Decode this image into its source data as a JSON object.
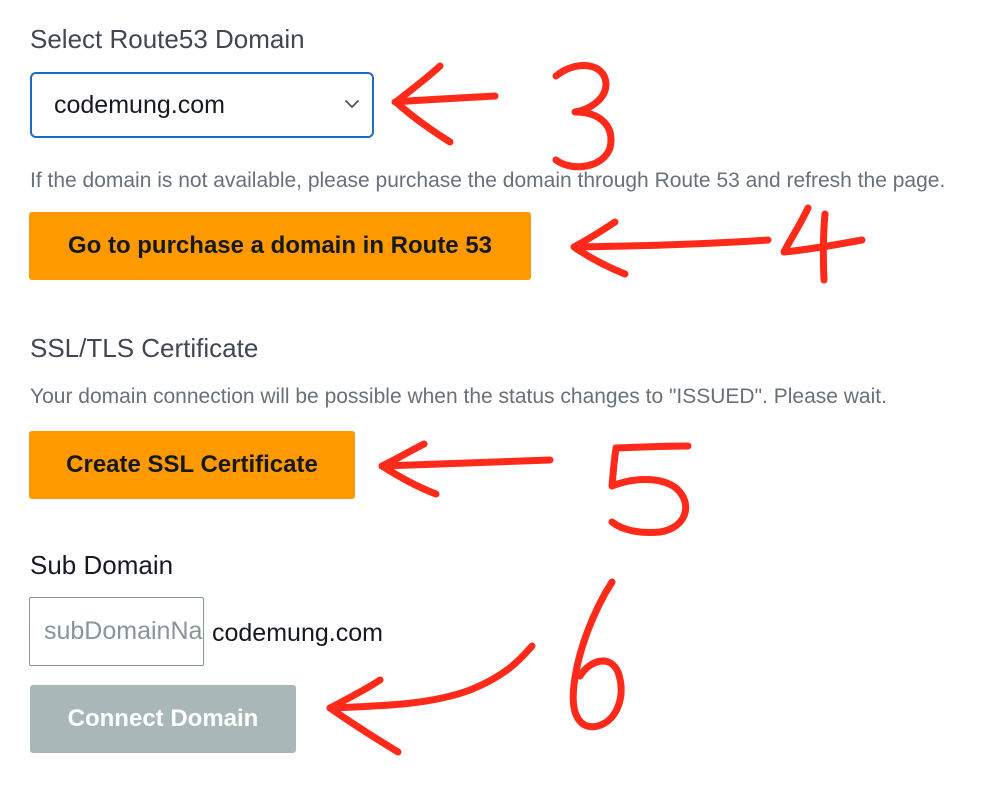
{
  "route53": {
    "label": "Select Route53 Domain",
    "selected_domain": "codemung.com",
    "help_text": "If the domain is not available, please purchase the domain through Route 53 and refresh the page.",
    "purchase_button": "Go to purchase a domain in Route 53"
  },
  "ssl": {
    "label": "SSL/TLS Certificate",
    "help_text": "Your domain connection will be possible when the status changes to \"ISSUED\". Please wait.",
    "create_button": "Create SSL Certificate"
  },
  "subdomain": {
    "label": "Sub Domain",
    "placeholder": "subDomainName",
    "domain_suffix": "codemung.com",
    "connect_button": "Connect Domain"
  },
  "annotations": {
    "color": "#ff2a1a",
    "step_numbers": [
      "3",
      "4",
      "5",
      "6"
    ]
  },
  "colors": {
    "primary_button": "#ff9900",
    "disabled_button": "#aab7b8",
    "focus_border": "#1f6ac3"
  }
}
